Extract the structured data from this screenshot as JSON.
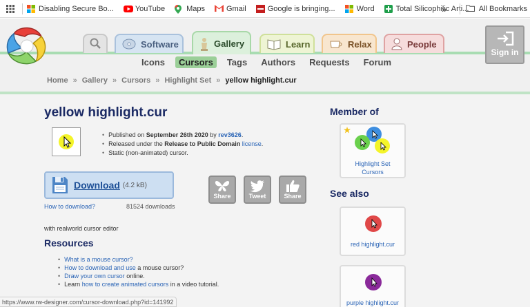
{
  "bookmarks": {
    "items": [
      {
        "label": "Disabling Secure Bo...",
        "icon": "windows-icon"
      },
      {
        "label": "YouTube",
        "icon": "youtube-icon"
      },
      {
        "label": "Maps",
        "icon": "maps-pin-icon"
      },
      {
        "label": "Gmail",
        "icon": "gmail-icon"
      },
      {
        "label": "Google is bringing...",
        "icon": "toi-icon"
      },
      {
        "label": "Word",
        "icon": "windows-icon"
      },
      {
        "label": "Total Silicophilic Arti...",
        "icon": "plus-square-icon"
      }
    ],
    "more": "»",
    "all_bookmarks": "All Bookmarks"
  },
  "header": {
    "tabs": [
      {
        "label": "Software"
      },
      {
        "label": "Gallery"
      },
      {
        "label": "Learn"
      },
      {
        "label": "Relax"
      },
      {
        "label": "People"
      }
    ],
    "sign_in": "Sign in",
    "subnav": [
      "Icons",
      "Cursors",
      "Tags",
      "Authors",
      "Requests",
      "Forum"
    ],
    "active_subnav": "Cursors",
    "breadcrumb": [
      "Home",
      "Gallery",
      "Cursors",
      "Highlight Set",
      "yellow highlight.cur"
    ],
    "breadcrumb_sep": "»"
  },
  "item": {
    "title": "yellow highlight.cur",
    "published_prefix": "Published on ",
    "published_date": "September 26th 2020",
    "published_by": " by ",
    "author": "rev3626",
    "released_prefix": "Released under the ",
    "license_name": "Release to Public Domain",
    "license_link": "license",
    "static_note": "Static (non-animated) cursor."
  },
  "download": {
    "label": "Download",
    "size": "(4.2 kB)",
    "how_to": "How to download?",
    "count": "81524 downloads"
  },
  "share": [
    {
      "label": "Share",
      "icon": "butterfly-icon"
    },
    {
      "label": "Tweet",
      "icon": "twitter-icon"
    },
    {
      "label": "Share",
      "icon": "thumbs-up-icon"
    }
  ],
  "editor_note": "with realworld cursor editor",
  "resources": {
    "heading": "Resources",
    "items": [
      {
        "link": "What is a mouse cursor?",
        "rest": ""
      },
      {
        "link": "How to download and use",
        "rest": " a mouse cursor?"
      },
      {
        "link": "Draw your own cursor",
        "rest": " online."
      },
      {
        "pre": "Learn ",
        "link": "how to create animated cursors",
        "rest": " in a video tutorial."
      }
    ]
  },
  "member_of": {
    "heading": "Member of",
    "set_label_1": "Highlight Set",
    "set_label_2": "Cursors"
  },
  "see_also": {
    "heading": "See also",
    "items": [
      {
        "label": "red highlight.cur",
        "color": "#e04848"
      },
      {
        "label": "purple highlight.cur",
        "color": "#8a2a9a"
      }
    ]
  },
  "status_url": "https://www.rw-designer.com/cursor-download.php?id=141992",
  "colors": {
    "highlight_yellow": "#f4f42a",
    "title_navy": "#1b2a64",
    "link_blue": "#2a64b6",
    "nav_green": "#9bcf98"
  }
}
